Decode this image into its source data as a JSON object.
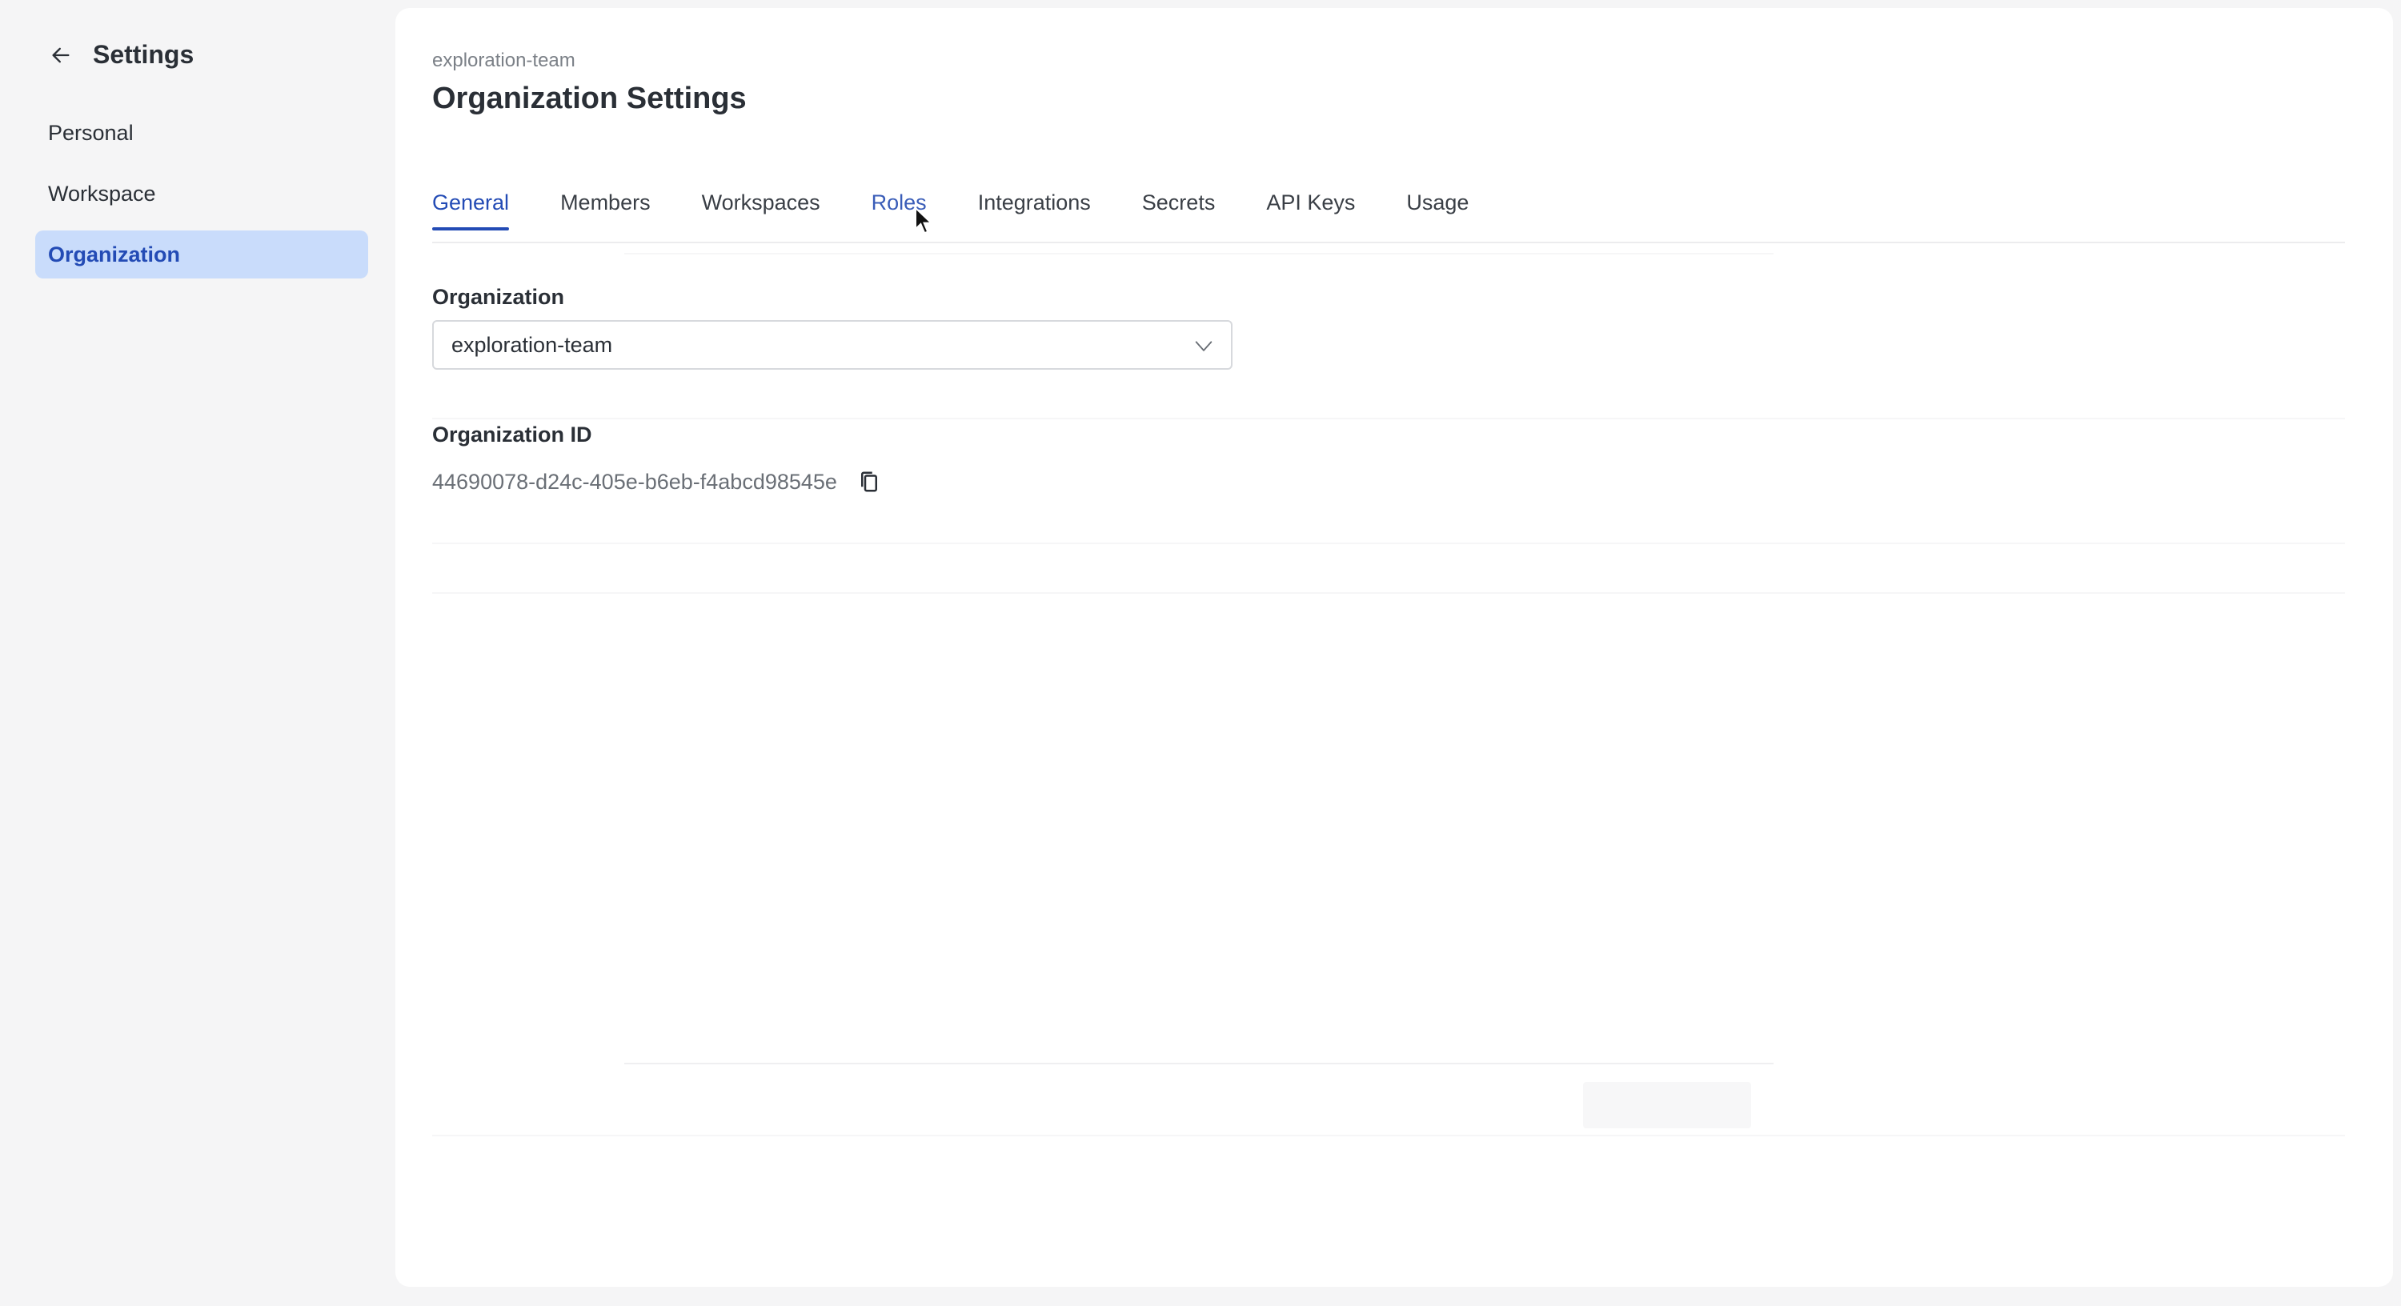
{
  "sidebar": {
    "title": "Settings",
    "back_icon": "arrow-left-icon",
    "items": [
      {
        "label": "Personal",
        "active": false
      },
      {
        "label": "Workspace",
        "active": false
      },
      {
        "label": "Organization",
        "active": true
      }
    ]
  },
  "main": {
    "breadcrumb": "exploration-team",
    "title": "Organization Settings",
    "tabs": [
      {
        "label": "General",
        "active": true
      },
      {
        "label": "Members",
        "active": false
      },
      {
        "label": "Workspaces",
        "active": false
      },
      {
        "label": "Roles",
        "active": false,
        "hovered": true
      },
      {
        "label": "Integrations",
        "active": false
      },
      {
        "label": "Secrets",
        "active": false
      },
      {
        "label": "API Keys",
        "active": false
      },
      {
        "label": "Usage",
        "active": false
      }
    ],
    "organization": {
      "label": "Organization",
      "selected": "exploration-team",
      "dropdown_icon": "chevron-down-icon"
    },
    "organization_id": {
      "label": "Organization ID",
      "value": "44690078-d24c-405e-b6eb-f4abcd98545e",
      "copy_icon": "copy-icon"
    }
  },
  "colors": {
    "accent": "#234bb5",
    "active_nav_bg": "#c9dcfb",
    "sidebar_bg": "#f5f5f6",
    "panel_bg": "#ffffff"
  }
}
